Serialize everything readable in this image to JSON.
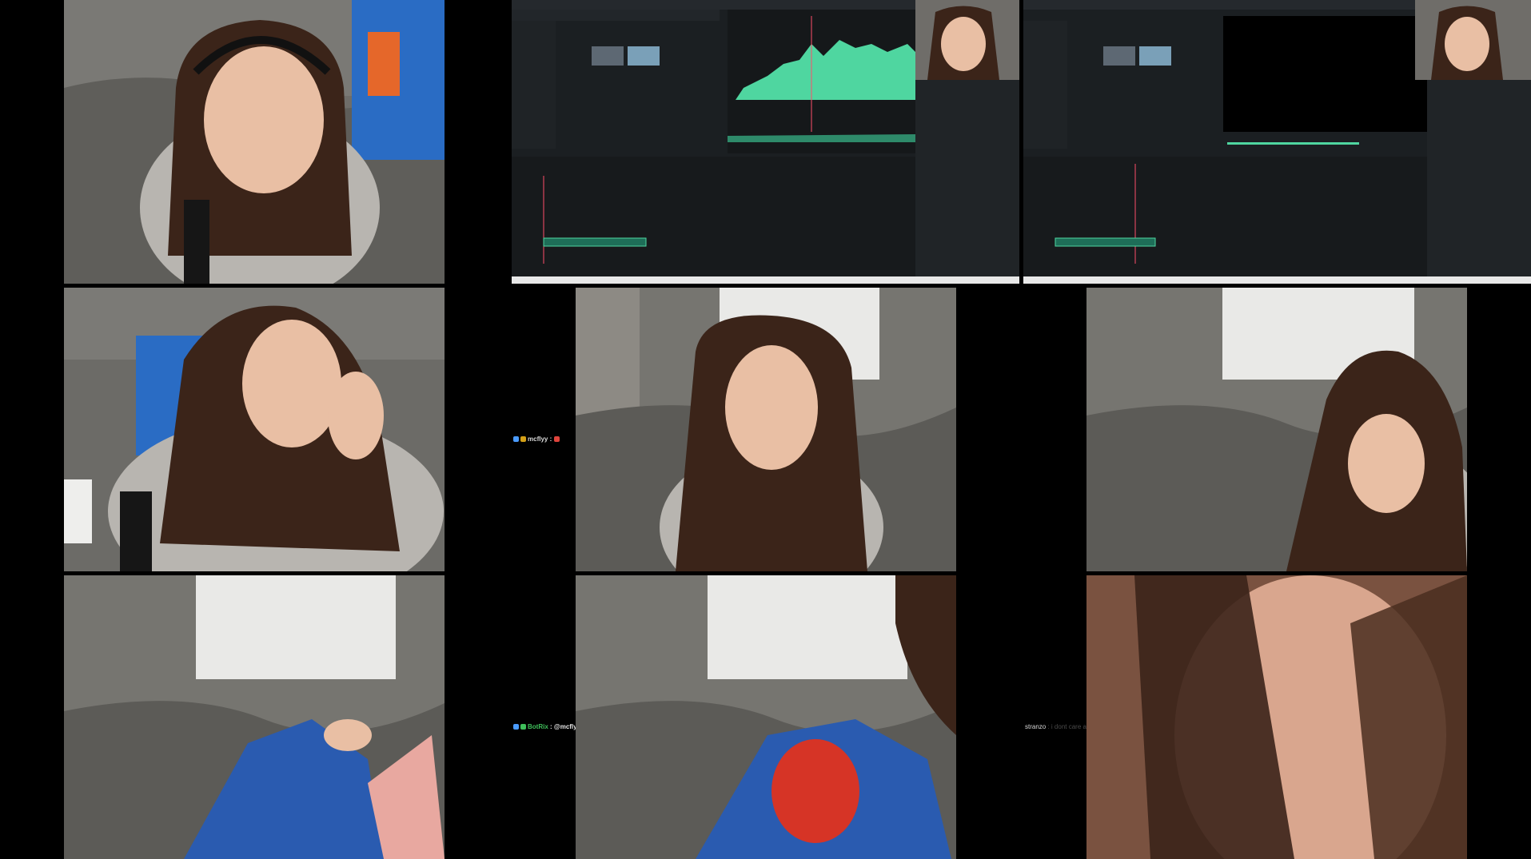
{
  "chat": [
    {
      "user": "mcflyy",
      "text": ":"
    },
    {
      "user": "BotRix",
      "text": ": @mcflyy The 'rizz' command was added correctly."
    },
    {
      "user": "stranzo",
      "text": ": i dont care a"
    }
  ],
  "colors": {
    "background": "#000000",
    "editor_bg": "#1b1f22",
    "waveform": "#4fd6a0",
    "playhead": "#ff4e6a",
    "wall": "#8c8a85",
    "bedding": "#6c6b67",
    "hair": "#3b2419",
    "hoodie": "#b8b5b0"
  },
  "icons": [
    "check-badge-icon",
    "crown-badge-icon",
    "bot-badge-icon",
    "emote-icon"
  ]
}
